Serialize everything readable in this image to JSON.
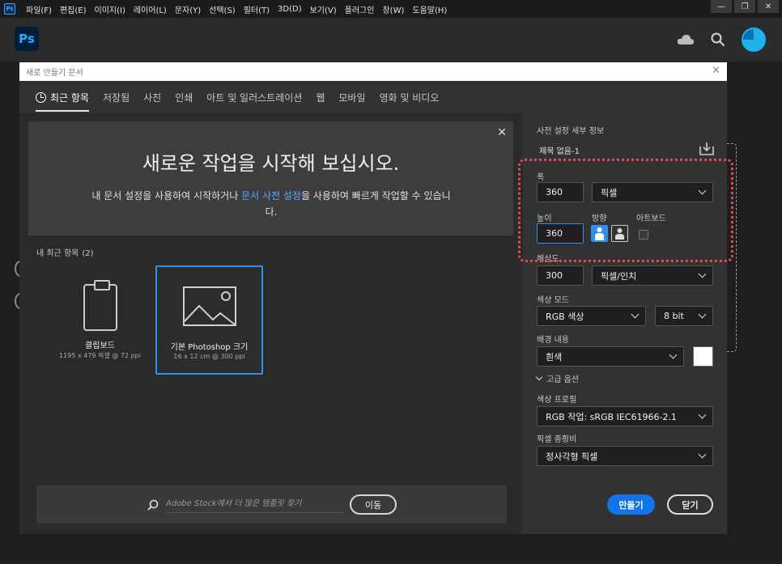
{
  "menubar": {
    "app_badge": "Ps",
    "items": [
      "파일(F)",
      "편집(E)",
      "이미지(I)",
      "레이어(L)",
      "문자(Y)",
      "선택(S)",
      "필터(T)",
      "3D(D)",
      "보기(V)",
      "플러그인",
      "창(W)",
      "도움말(H)"
    ],
    "controls": [
      "—",
      "❐",
      "✕"
    ]
  },
  "appbar": {
    "logo": "Ps"
  },
  "dialog": {
    "title": "새로 만들기 문서",
    "close": "✕",
    "tabs": [
      "최근 항목",
      "저장됨",
      "사진",
      "인쇄",
      "아트 및 일러스트레이션",
      "웹",
      "모바일",
      "영화 및 비디오"
    ],
    "banner": {
      "title": "새로운 작업을 시작해 보십시오.",
      "desc_pre": "내 문서 설정을 사용하여 시작하거나 ",
      "desc_link": "문서 사전 설정",
      "desc_post": "을 사용하여 빠르게 작업할 수 있습니다.",
      "close": "✕"
    },
    "recent": {
      "label": "내 최근 항목",
      "count": "(2)",
      "items": [
        {
          "title": "클립보드",
          "meta": "1195 x 479 픽셀 @ 72 ppi"
        },
        {
          "title": "기본 Photoshop 크기",
          "meta": "16 x 12 cm @ 300 ppi"
        }
      ]
    },
    "search": {
      "placeholder": "Adobe Stock에서 더 많은 템플릿 찾기",
      "go_label": "이동"
    },
    "details": {
      "heading": "사전 설정 세부 정보",
      "doc_name": "제목 없음-1",
      "width_label": "폭",
      "width_value": "360",
      "width_unit": "픽셀",
      "height_label": "높이",
      "height_value": "360",
      "orientation_label": "방향",
      "artboard_label": "아트보드",
      "resolution_label": "해상도",
      "resolution_value": "300",
      "resolution_unit": "픽셀/인치",
      "color_mode_label": "색상 모드",
      "color_mode": "RGB 색상",
      "bit_depth": "8 bit",
      "background_label": "배경 내용",
      "background": "흰색",
      "background_color": "#ffffff",
      "advanced_label": "고급 옵션",
      "profile_label": "색상 프로필",
      "profile": "RGB 작업: sRGB IEC61966-2.1",
      "pixel_aspect_label": "픽셀 종횡비",
      "pixel_aspect": "정사각형 픽셀",
      "create_label": "만들기",
      "close_label": "닫기"
    }
  },
  "colors": {
    "accent": "#1473e6",
    "highlight": "#e0495e"
  }
}
